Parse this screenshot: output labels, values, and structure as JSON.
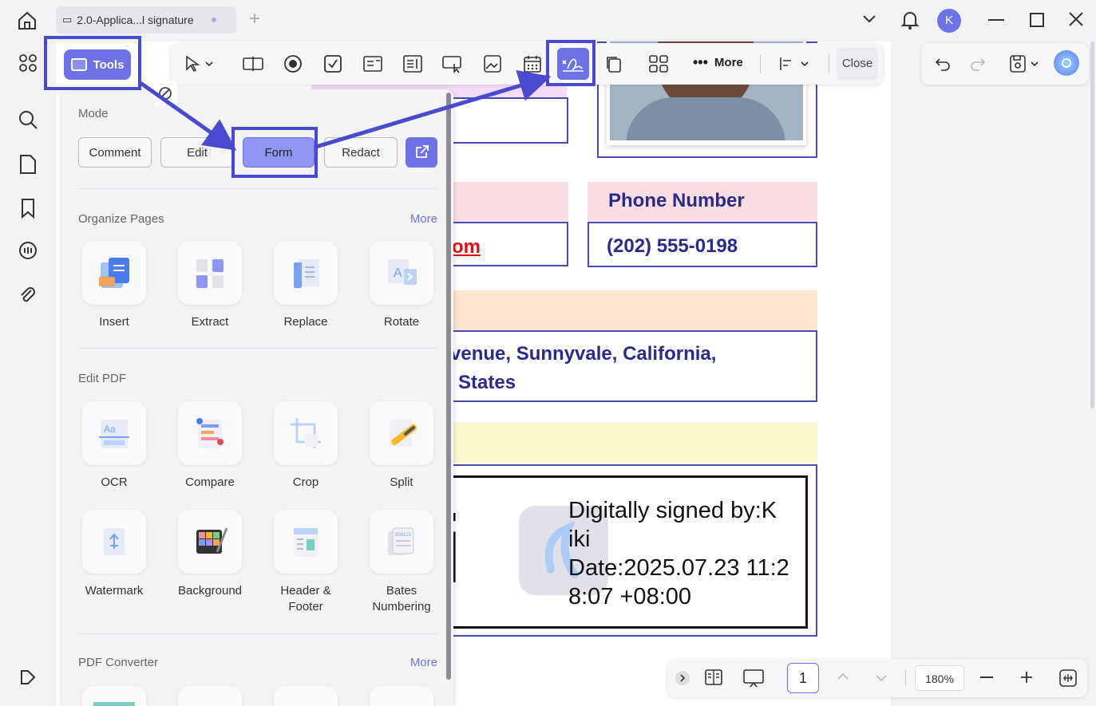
{
  "titlebar": {
    "tab_title": "2.0-Applica...l signature",
    "new_tab": "+",
    "avatar_initial": "K"
  },
  "toolbar": {
    "tools_label": "Tools",
    "more_label": "More",
    "close_label": "Close"
  },
  "panel": {
    "mode_title": "Mode",
    "modes": [
      "Comment",
      "Edit",
      "Form",
      "Redact"
    ],
    "organize": {
      "title": "Organize Pages",
      "more": "More",
      "items": [
        "Insert",
        "Extract",
        "Replace",
        "Rotate"
      ]
    },
    "edit_pdf": {
      "title": "Edit PDF",
      "items": [
        "OCR",
        "Compare",
        "Crop",
        "Split",
        "Watermark",
        "Background",
        "Header & Footer",
        "Bates Numbering"
      ]
    },
    "converter": {
      "title": "PDF Converter",
      "more": "More"
    }
  },
  "document": {
    "phone_label": "Phone Number",
    "phone_value": "(202) 555-0198",
    "email_fragment": "om",
    "address_line1": "venue, Sunnyvale, California,",
    "address_line2": "States",
    "signature_big": "ki",
    "sig_line1": "Digitally signed by:K",
    "sig_line2": "iki",
    "sig_line3": "Date:2025.07.23 11:2",
    "sig_line4": "8:07 +08:00"
  },
  "bottombar": {
    "page": "1",
    "zoom": "180%"
  },
  "colors": {
    "accent": "#6d73e6",
    "highlight": "#4a4ad0",
    "form_text": "#2a2a8a",
    "pink_header": "#fbdde4",
    "peach_header": "#fde6cf",
    "yellow_header": "#fdf9cf"
  }
}
